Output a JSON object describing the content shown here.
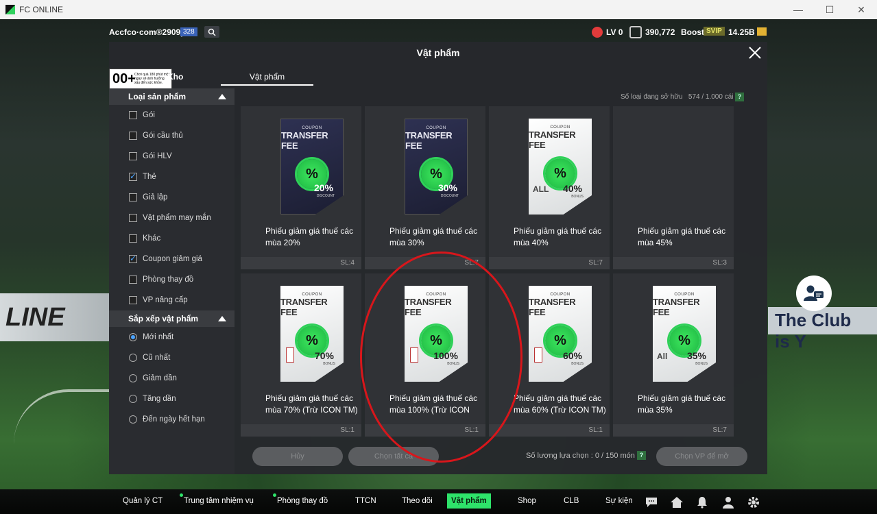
{
  "window": {
    "title": "FC ONLINE",
    "minimize": "—",
    "maximize": "☐",
    "close": "✕"
  },
  "topbar": {
    "account": "Accfco·com®2909p",
    "account_level": "328",
    "lv": "LV 0",
    "coins": "390,772",
    "boost": "Boost",
    "svip": "SVIP",
    "bp": "14.25B"
  },
  "modal": {
    "title": "Vật phẩm",
    "age_rating": "00+",
    "age_text": "Chơi quá 180 phút một ngày sẽ ảnh hưởng xấu đến sức khỏe.",
    "tab_kho": "Kho",
    "tab_vatpham": "Vật phẩm",
    "owned_label": "Số loại đang sở hữu",
    "owned_value": "574 / 1.000 cái",
    "help": "?"
  },
  "filters": {
    "product_type_header": "Loại sản phẩm",
    "product_types": [
      {
        "label": "Gói",
        "checked": false
      },
      {
        "label": "Gói cầu thủ",
        "checked": false
      },
      {
        "label": "Gói HLV",
        "checked": false
      },
      {
        "label": "Thẻ",
        "checked": true
      },
      {
        "label": "Giả lập",
        "checked": false
      },
      {
        "label": "Vật phẩm may mắn",
        "checked": false
      },
      {
        "label": "Khác",
        "checked": false
      },
      {
        "label": "Coupon giảm giá",
        "checked": true
      },
      {
        "label": "Phòng thay đồ",
        "checked": false
      },
      {
        "label": "VP nâng cấp",
        "checked": false
      }
    ],
    "sort_header": "Sắp xếp vật phẩm",
    "sort_options": [
      {
        "label": "Mới nhất",
        "selected": true
      },
      {
        "label": "Cũ nhất",
        "selected": false
      },
      {
        "label": "Giảm dần",
        "selected": false
      },
      {
        "label": "Tăng dần",
        "selected": false
      },
      {
        "label": "Đến ngày hết hạn",
        "selected": false
      }
    ]
  },
  "items": [
    {
      "name": "Phiếu giảm giá thuế các mùa 20%",
      "qty": "SL:4",
      "style": "dark",
      "coupon_tag": "COUPON",
      "coupon_title": "TRANSFER FEE",
      "seal": "%",
      "pct": "20%",
      "pct_sub": "DISCOUNT",
      "mark": ""
    },
    {
      "name": "Phiếu giảm giá thuế các mùa 30%",
      "qty": "SL:7",
      "style": "dark",
      "coupon_tag": "COUPON",
      "coupon_title": "TRANSFER FEE",
      "seal": "%",
      "pct": "30%",
      "pct_sub": "DISCOUNT",
      "mark": ""
    },
    {
      "name": "Phiếu giảm giá thuế các mùa 40%",
      "qty": "SL:7",
      "style": "white",
      "coupon_tag": "COUPON",
      "coupon_title": "TRANSFER FEE",
      "seal": "%",
      "pct": "40%",
      "pct_sub": "BONUS",
      "mark": "ALL"
    },
    {
      "name": "Phiếu giảm giá thuế các mùa 45%",
      "qty": "SL:3",
      "style": "none",
      "coupon_tag": "",
      "coupon_title": "",
      "seal": "",
      "pct": "",
      "pct_sub": "",
      "mark": ""
    },
    {
      "name": "Phiếu giảm giá thuế các mùa 70% (Trừ ICON TM)",
      "qty": "SL:1",
      "style": "white",
      "coupon_tag": "COUPON",
      "coupon_title": "TRANSFER FEE",
      "seal": "%",
      "pct": "70%",
      "pct_sub": "BONUS",
      "mark": "stamp"
    },
    {
      "name": "Phiếu giảm giá thuế các mùa 100% (Trừ ICON",
      "qty": "SL:1",
      "style": "white",
      "coupon_tag": "COUPON",
      "coupon_title": "TRANSFER FEE",
      "seal": "%",
      "pct": "100%",
      "pct_sub": "BONUS",
      "mark": "stamp"
    },
    {
      "name": "Phiếu giảm giá thuế các mùa 60% (Trừ ICON TM)",
      "qty": "SL:1",
      "style": "white",
      "coupon_tag": "COUPON",
      "coupon_title": "TRANSFER FEE",
      "seal": "%",
      "pct": "60%",
      "pct_sub": "BONUS",
      "mark": "stamp"
    },
    {
      "name": "Phiếu giảm giá thuế các mùa 35%",
      "qty": "SL:7",
      "style": "white",
      "coupon_tag": "COUPON",
      "coupon_title": "TRANSFER FEE",
      "seal": "%",
      "pct": "35%",
      "pct_sub": "BONUS",
      "mark": "All"
    }
  ],
  "footer": {
    "cancel": "Hủy",
    "select_all": "Chọn tất cả",
    "select_count": "Số lượng lựa chọn : 0 / 150 món",
    "select_vp": "Chọn VP để mở"
  },
  "background": {
    "banner_left": "LINE",
    "banner_right": "The Club is Y"
  },
  "nav": [
    {
      "label": "Quản lý CT",
      "active": false,
      "dot": false
    },
    {
      "label": "Trung tâm nhiệm vụ",
      "active": false,
      "dot": true
    },
    {
      "label": "Phòng thay đồ",
      "active": false,
      "dot": true
    },
    {
      "label": "TTCN",
      "active": false,
      "dot": false
    },
    {
      "label": "Theo dõi",
      "active": false,
      "dot": false
    },
    {
      "label": "Vật phẩm",
      "active": true,
      "dot": false
    },
    {
      "label": "Shop",
      "active": false,
      "dot": false
    },
    {
      "label": "CLB",
      "active": false,
      "dot": false
    },
    {
      "label": "Sự kiện",
      "active": false,
      "dot": false
    }
  ],
  "nav_icons": [
    "chat-icon",
    "home-icon",
    "bell-icon",
    "profile-icon",
    "settings-icon"
  ],
  "colors": {
    "accent": "#2ee36a",
    "annotation": "#d8161b",
    "check": "#4aa3ff"
  }
}
